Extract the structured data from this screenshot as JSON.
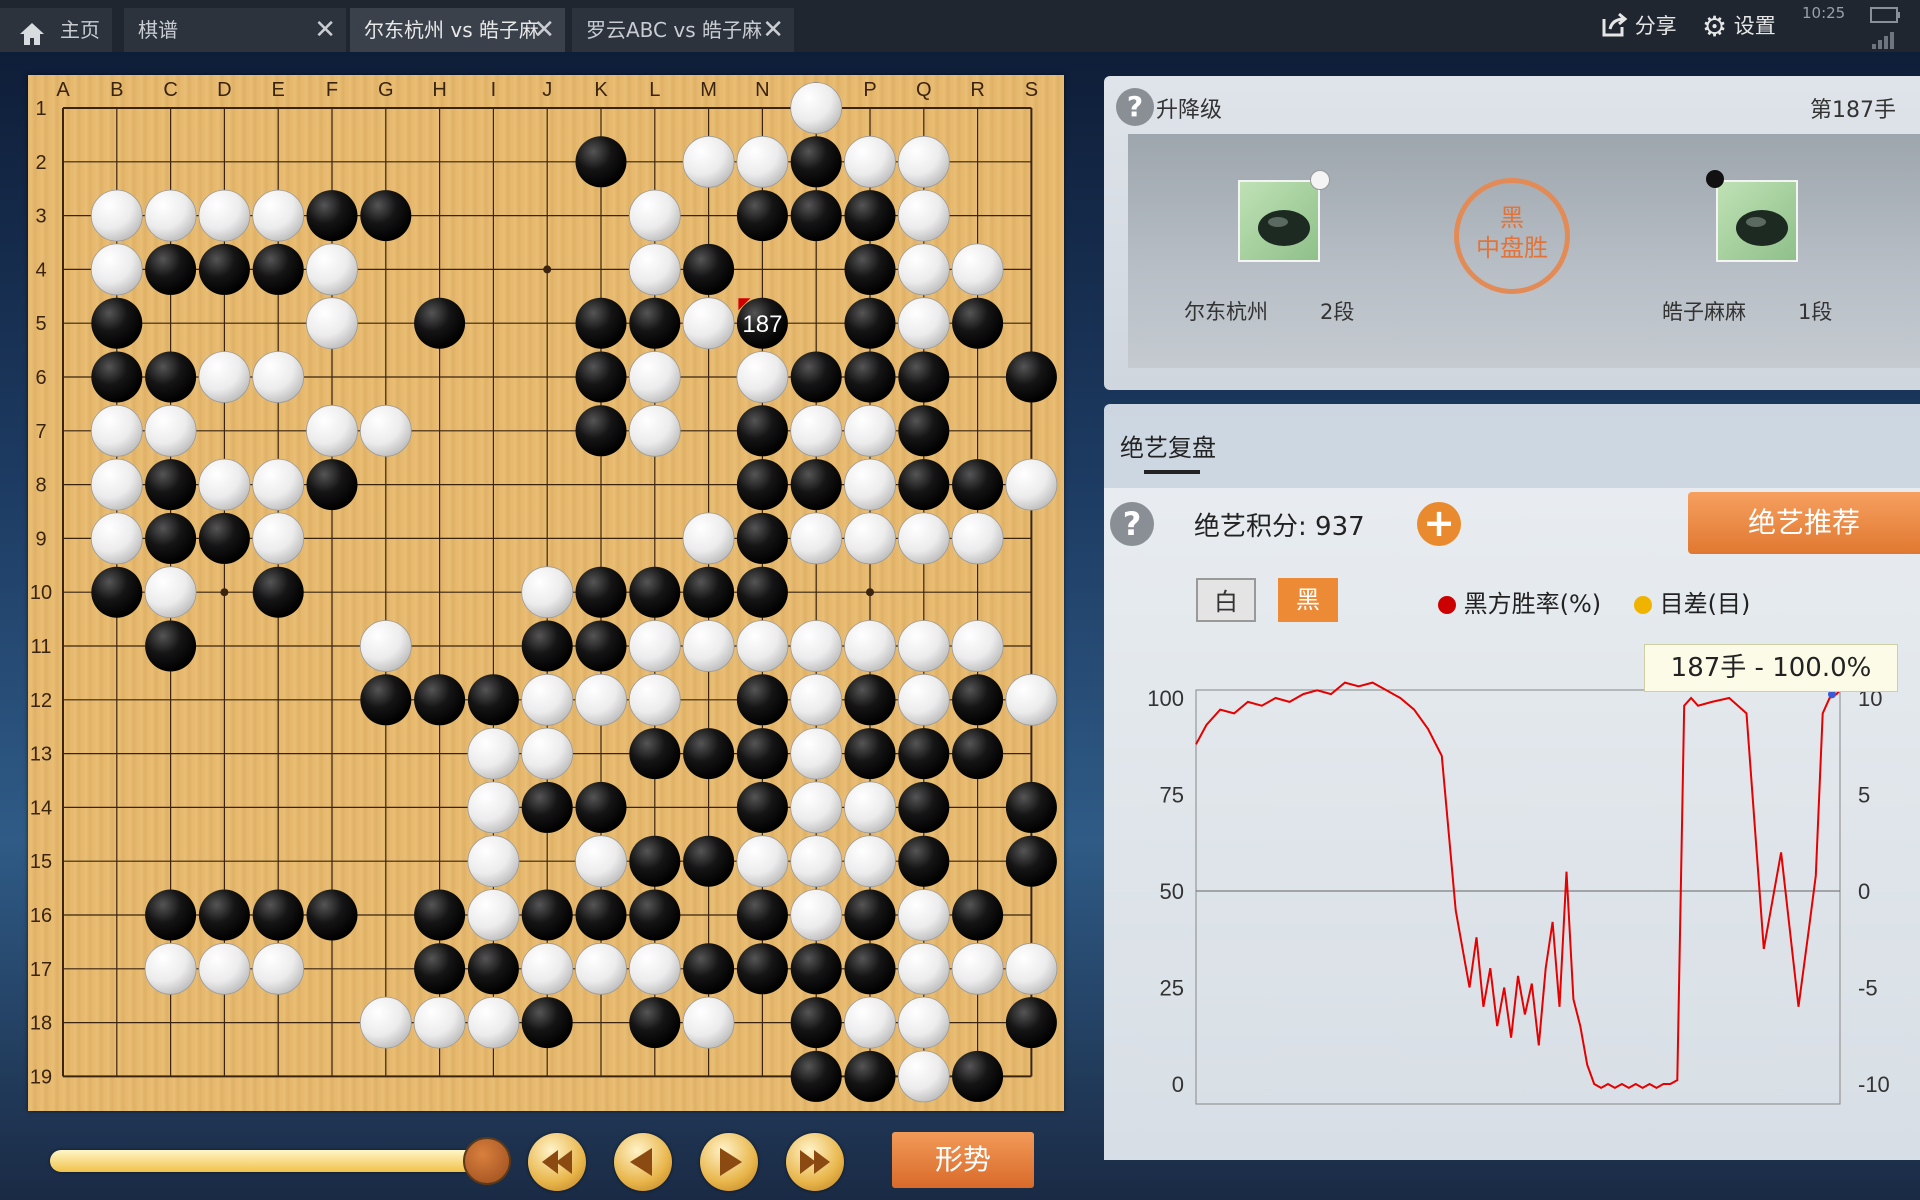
{
  "tabs": [
    {
      "label": "主页",
      "closable": false,
      "active": false
    },
    {
      "label": "棋谱",
      "closable": true,
      "active": false
    },
    {
      "label": "尔东杭州 vs 皓子麻",
      "closable": true,
      "active": true
    },
    {
      "label": "罗云ABC vs 皓子麻",
      "closable": true,
      "active": false
    }
  ],
  "toolbar": {
    "share_label": "分享",
    "settings_label": "设置"
  },
  "status_bar": {
    "time": "10:25"
  },
  "board": {
    "size": 19,
    "col_labels": [
      "A",
      "B",
      "C",
      "D",
      "E",
      "F",
      "G",
      "H",
      "I",
      "J",
      "K",
      "L",
      "M",
      "N",
      "O",
      "P",
      "Q",
      "R",
      "S"
    ],
    "black": [
      "K2",
      "O2",
      "F3",
      "G3",
      "N3",
      "O3",
      "P3",
      "C4",
      "D4",
      "E4",
      "M4",
      "P4",
      "B5",
      "H5",
      "K5",
      "L5",
      "N5",
      "P5",
      "R5",
      "B6",
      "C6",
      "K6",
      "O6",
      "P6",
      "Q6",
      "S6",
      "K7",
      "N7",
      "Q7",
      "C8",
      "F8",
      "N8",
      "O8",
      "Q8",
      "R8",
      "C9",
      "D9",
      "N9",
      "B10",
      "E10",
      "K10",
      "L10",
      "M10",
      "N10",
      "C11",
      "J11",
      "K11",
      "G12",
      "H12",
      "I12",
      "N12",
      "P12",
      "R12",
      "L13",
      "M13",
      "N13",
      "P13",
      "Q13",
      "R13",
      "J14",
      "K14",
      "N14",
      "Q14",
      "S14",
      "L15",
      "M15",
      "Q15",
      "S15",
      "C16",
      "D16",
      "E16",
      "F16",
      "H16",
      "J16",
      "K16",
      "L16",
      "N16",
      "P16",
      "R16",
      "H17",
      "I17",
      "M17",
      "N17",
      "O17",
      "P17",
      "J18",
      "L18",
      "O18",
      "S18",
      "O19",
      "P19",
      "R19"
    ],
    "white": [
      "O1",
      "M2",
      "N2",
      "P2",
      "Q2",
      "B3",
      "C3",
      "D3",
      "E3",
      "L3",
      "Q3",
      "B4",
      "F4",
      "L4",
      "Q4",
      "R4",
      "F5",
      "M5",
      "Q5",
      "D6",
      "E6",
      "L6",
      "N6",
      "B7",
      "C7",
      "F7",
      "G7",
      "L7",
      "O7",
      "P7",
      "B8",
      "D8",
      "E8",
      "P8",
      "S8",
      "B9",
      "E9",
      "M9",
      "O9",
      "P9",
      "Q9",
      "R9",
      "C10",
      "J10",
      "G11",
      "L11",
      "M11",
      "N11",
      "O11",
      "P11",
      "Q11",
      "R11",
      "J12",
      "K12",
      "L12",
      "O12",
      "Q12",
      "S12",
      "I13",
      "J13",
      "O13",
      "I14",
      "O14",
      "P14",
      "I15",
      "K15",
      "N15",
      "O15",
      "P15",
      "I16",
      "O16",
      "Q16",
      "C17",
      "D17",
      "E17",
      "J17",
      "K17",
      "L17",
      "Q17",
      "R17",
      "S17",
      "G18",
      "H18",
      "I18",
      "M18",
      "P18",
      "Q18",
      "Q19"
    ],
    "last_move": {
      "coord": "N5",
      "color": "black",
      "number": "187"
    }
  },
  "game_info": {
    "title": "升降级",
    "move_label": "第187手",
    "black_player": {
      "name": "尔东杭州",
      "rank": "2段"
    },
    "white_player": {
      "name": "皓子麻麻",
      "rank": "1段"
    },
    "result_line1": "黑",
    "result_line2": "中盘胜"
  },
  "ai_review": {
    "tab_label": "绝艺复盘",
    "score_label": "绝艺积分: 937",
    "recommend_label": "绝艺推荐",
    "white_btn": "白",
    "black_btn": "黑",
    "legend_winrate": "黑方胜率(%)",
    "legend_diff": "目差(目)",
    "tooltip": "187手 - 100.0%"
  },
  "trend_label": "形势",
  "colors": {
    "accent_orange": "#e07830",
    "winrate_line": "#e60000",
    "diff_dot": "#f0b400",
    "black_dot": "#cc0000"
  },
  "chart_data": {
    "type": "line",
    "x_range": [
      1,
      187
    ],
    "ylim_left": [
      0,
      100
    ],
    "ylim_right": [
      -10,
      10
    ],
    "yticks_left": [
      "100",
      "75",
      "50",
      "25",
      "0"
    ],
    "yticks_right": [
      "10",
      "5",
      "0",
      "-5",
      "-10"
    ],
    "series": [
      {
        "name": "黑方胜率(%)",
        "color": "#e60000",
        "x": [
          1,
          4,
          8,
          12,
          16,
          20,
          24,
          28,
          32,
          36,
          40,
          44,
          48,
          52,
          56,
          60,
          64,
          68,
          72,
          76,
          80,
          82,
          84,
          86,
          88,
          90,
          92,
          94,
          96,
          98,
          100,
          102,
          104,
          106,
          108,
          110,
          112,
          114,
          116,
          118,
          120,
          122,
          124,
          126,
          128,
          130,
          132,
          134,
          136,
          138,
          140,
          142,
          144,
          146,
          150,
          155,
          160,
          165,
          170,
          175,
          178,
          180,
          182,
          184,
          186,
          187
        ],
        "y": [
          88,
          93,
          97,
          96,
          99,
          98,
          100,
          99,
          101,
          102,
          101,
          104,
          103,
          104,
          102,
          100,
          97,
          92,
          85,
          45,
          25,
          38,
          20,
          30,
          15,
          25,
          12,
          28,
          18,
          26,
          10,
          30,
          42,
          20,
          55,
          22,
          15,
          5,
          0,
          -1,
          0,
          -1,
          0,
          -1,
          0,
          -1,
          0,
          -1,
          0,
          0,
          1,
          98,
          100,
          98,
          99,
          100,
          96,
          35,
          60,
          20,
          40,
          54,
          96,
          100,
          101,
          102
        ]
      },
      {
        "name": "目差(目)",
        "color": "#f0b400",
        "x": [],
        "y": []
      }
    ],
    "highlight": {
      "x": 187,
      "label": "187手 - 100.0%"
    }
  }
}
